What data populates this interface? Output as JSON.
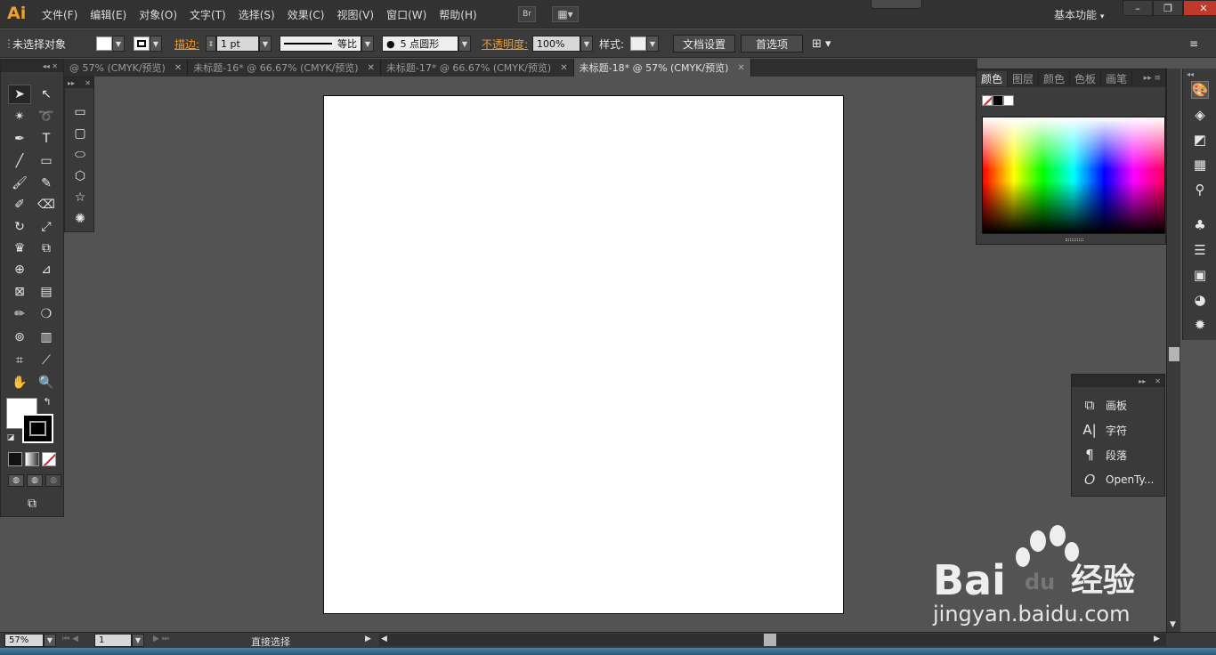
{
  "app": {
    "logo": "Ai",
    "menus": [
      "文件(F)",
      "编辑(E)",
      "对象(O)",
      "文字(T)",
      "选择(S)",
      "效果(C)",
      "视图(V)",
      "窗口(W)",
      "帮助(H)"
    ],
    "bridge_label": "Br",
    "workspace_label": "基本功能",
    "win_min": "–",
    "win_restore": "❐",
    "win_close": "✕"
  },
  "control": {
    "selection": "未选择对象",
    "stroke_label": "描边:",
    "stroke_weight": "1 pt",
    "stroke_profile": "等比",
    "brush": "5 点圆形",
    "opacity_label": "不透明度:",
    "opacity_value": "100%",
    "style_label": "样式:",
    "doc_setup": "文档设置",
    "preferences": "首选项"
  },
  "tabs": [
    {
      "label": "@ 57% (CMYK/预览)",
      "active": false
    },
    {
      "label": "未标题-16* @ 66.67% (CMYK/预览)",
      "active": false
    },
    {
      "label": "未标题-17* @ 66.67% (CMYK/预览)",
      "active": false
    },
    {
      "label": "未标题-18* @ 57% (CMYK/预览)",
      "active": true
    }
  ],
  "tab_close": "✕",
  "color_panel": {
    "tabs": [
      "颜色",
      "图层",
      "颜色",
      "色板",
      "画笔"
    ]
  },
  "mini_panel": {
    "items": [
      {
        "label": "画板",
        "icon": "artboards-icon"
      },
      {
        "label": "字符",
        "icon": "character-icon"
      },
      {
        "label": "段落",
        "icon": "paragraph-icon"
      },
      {
        "label": "OpenTy...",
        "icon": "opentype-icon"
      }
    ]
  },
  "status": {
    "zoom": "57%",
    "page": "1",
    "tool": "直接选择"
  },
  "watermark": {
    "brand": "Bai",
    "brand2": "du",
    "product": "经验",
    "url": "jingyan.baidu.com"
  },
  "colors": {
    "accent": "#f29a2c",
    "bg": "#535353",
    "panel": "#3a3a3a"
  }
}
